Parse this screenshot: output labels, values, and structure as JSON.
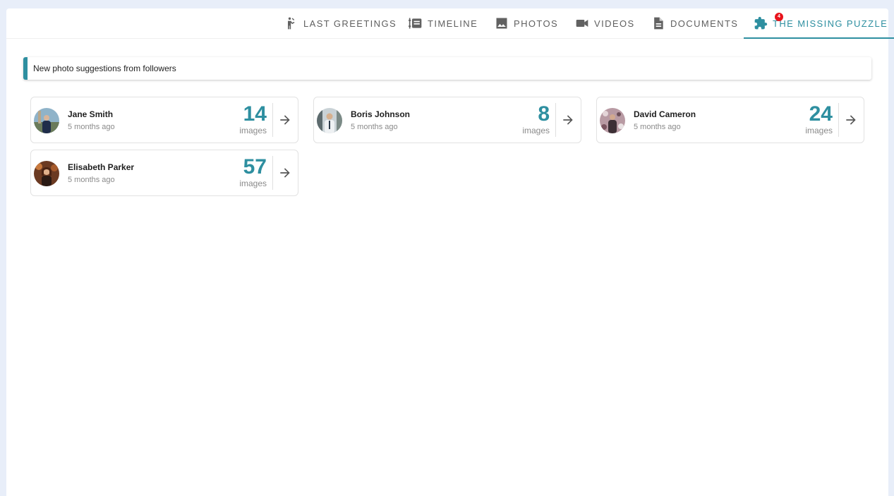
{
  "tabs": [
    {
      "label": "LAST GREETINGS",
      "icon": "greeting-person-icon"
    },
    {
      "label": "TIMELINE",
      "icon": "timeline-list-icon"
    },
    {
      "label": "PHOTOS",
      "icon": "image-icon"
    },
    {
      "label": "VIDEOS",
      "icon": "videocam-icon"
    },
    {
      "label": "DOCUMENTS",
      "icon": "document-icon"
    },
    {
      "label": "THE MISSING PUZZLE",
      "icon": "puzzle-icon",
      "badge": "4",
      "active": true
    }
  ],
  "notice": {
    "text": "New photo suggestions from followers"
  },
  "unit_label": "images",
  "suggestions": [
    {
      "name": "Jane Smith",
      "time": "5 months ago",
      "count": "14"
    },
    {
      "name": "Boris Johnson",
      "time": "5 months ago",
      "count": "8"
    },
    {
      "name": "David Cameron",
      "time": "5 months ago",
      "count": "24"
    },
    {
      "name": "Elisabeth Parker",
      "time": "5 months ago",
      "count": "57"
    }
  ],
  "colors": {
    "accent": "#2e8fa0",
    "badge": "#e8141c",
    "background": "#e8eef9"
  }
}
